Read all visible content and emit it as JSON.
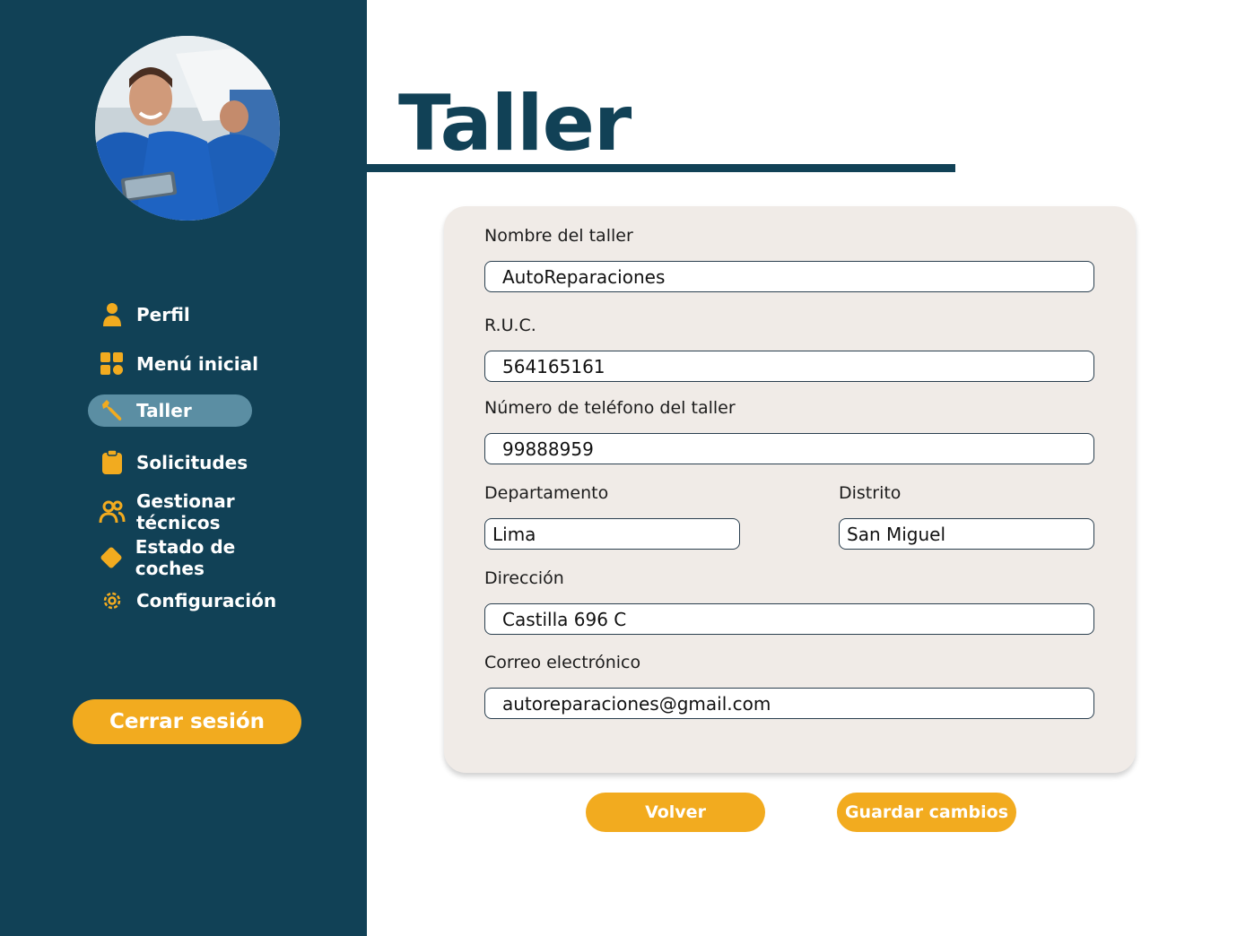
{
  "sidebar": {
    "nav": [
      {
        "label": "Perfil",
        "icon": "user-icon"
      },
      {
        "label": "Menú inicial",
        "icon": "grid-icon"
      },
      {
        "label": "Taller",
        "icon": "wrench-icon"
      },
      {
        "label": "Solicitudes",
        "icon": "clipboard-icon"
      },
      {
        "label": "Gestionar técnicos",
        "icon": "users-icon"
      },
      {
        "label": "Estado de coches",
        "icon": "diamond-icon"
      },
      {
        "label": "Configuración",
        "icon": "gear-icon"
      }
    ],
    "active_item": "Taller",
    "logout_label": "Cerrar sesión"
  },
  "page": {
    "title": "Taller"
  },
  "form": {
    "nombre": {
      "label": "Nombre del taller",
      "value": "AutoReparaciones"
    },
    "ruc": {
      "label": "R.U.C.",
      "value": "564165161"
    },
    "telefono": {
      "label": "Número de teléfono del taller",
      "value": "99888959"
    },
    "departamento": {
      "label": "Departamento",
      "value": "Lima"
    },
    "distrito": {
      "label": "Distrito",
      "value": "San Miguel"
    },
    "direccion": {
      "label": "Dirección",
      "value": "Castilla 696 C"
    },
    "correo": {
      "label": "Correo electrónico",
      "value": "autoreparaciones@gmail.com"
    }
  },
  "actions": {
    "back_label": "Volver",
    "save_label": "Guardar cambios"
  },
  "colors": {
    "sidebar": "#114156",
    "accent": "#f2ab1f",
    "active_nav": "#5b8ea3",
    "card": "#f0ebe7"
  }
}
